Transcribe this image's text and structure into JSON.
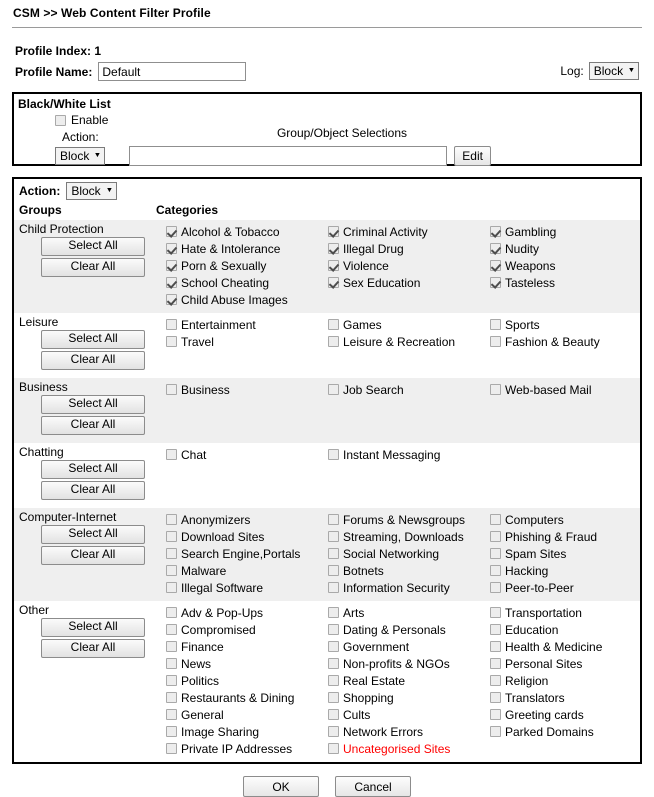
{
  "header": {
    "breadcrumb": "CSM >> Web Content Filter Profile"
  },
  "profile": {
    "index_label": "Profile Index: 1",
    "name_label": "Profile Name:",
    "name_value": "Default",
    "log_label": "Log:",
    "log_value": "Block"
  },
  "black_white_list": {
    "title": "Black/White List",
    "enable_label": "Enable",
    "enable_checked": false,
    "action_label": "Action:",
    "action_value": "Block",
    "group_object_label": "Group/Object Selections",
    "group_object_value": "",
    "edit_label": "Edit"
  },
  "filter": {
    "action_label": "Action:",
    "action_value": "Block",
    "groups_header": "Groups",
    "categories_header": "Categories",
    "select_all_label": "Select All",
    "clear_all_label": "Clear All",
    "groups": [
      {
        "name": "Child Protection",
        "shaded": true,
        "columns": [
          [
            {
              "label": "Alcohol & Tobacco",
              "checked": true
            },
            {
              "label": "Hate & Intolerance",
              "checked": true
            },
            {
              "label": "Porn & Sexually",
              "checked": true
            },
            {
              "label": "School Cheating",
              "checked": true
            },
            {
              "label": "Child Abuse Images",
              "checked": true
            }
          ],
          [
            {
              "label": "Criminal Activity",
              "checked": true
            },
            {
              "label": "Illegal Drug",
              "checked": true
            },
            {
              "label": "Violence",
              "checked": true
            },
            {
              "label": "Sex Education",
              "checked": true
            }
          ],
          [
            {
              "label": "Gambling",
              "checked": true
            },
            {
              "label": "Nudity",
              "checked": true
            },
            {
              "label": "Weapons",
              "checked": true
            },
            {
              "label": "Tasteless",
              "checked": true
            }
          ]
        ]
      },
      {
        "name": "Leisure",
        "shaded": false,
        "columns": [
          [
            {
              "label": "Entertainment",
              "checked": false
            },
            {
              "label": "Travel",
              "checked": false
            }
          ],
          [
            {
              "label": "Games",
              "checked": false
            },
            {
              "label": "Leisure & Recreation",
              "checked": false
            }
          ],
          [
            {
              "label": "Sports",
              "checked": false
            },
            {
              "label": "Fashion & Beauty",
              "checked": false
            }
          ]
        ]
      },
      {
        "name": "Business",
        "shaded": true,
        "columns": [
          [
            {
              "label": "Business",
              "checked": false
            }
          ],
          [
            {
              "label": "Job Search",
              "checked": false
            }
          ],
          [
            {
              "label": "Web-based Mail",
              "checked": false
            }
          ]
        ]
      },
      {
        "name": "Chatting",
        "shaded": false,
        "columns": [
          [
            {
              "label": "Chat",
              "checked": false
            }
          ],
          [
            {
              "label": "Instant Messaging",
              "checked": false
            }
          ],
          []
        ]
      },
      {
        "name": "Computer-Internet",
        "shaded": true,
        "columns": [
          [
            {
              "label": "Anonymizers",
              "checked": false
            },
            {
              "label": "Download Sites",
              "checked": false
            },
            {
              "label": "Search Engine,Portals",
              "checked": false
            },
            {
              "label": "Malware",
              "checked": false
            },
            {
              "label": "Illegal Software",
              "checked": false
            }
          ],
          [
            {
              "label": "Forums & Newsgroups",
              "checked": false
            },
            {
              "label": "Streaming, Downloads",
              "checked": false
            },
            {
              "label": "Social Networking",
              "checked": false
            },
            {
              "label": "Botnets",
              "checked": false
            },
            {
              "label": "Information Security",
              "checked": false
            }
          ],
          [
            {
              "label": "Computers",
              "checked": false
            },
            {
              "label": "Phishing & Fraud",
              "checked": false
            },
            {
              "label": "Spam Sites",
              "checked": false
            },
            {
              "label": "Hacking",
              "checked": false
            },
            {
              "label": "Peer-to-Peer",
              "checked": false
            }
          ]
        ]
      },
      {
        "name": "Other",
        "shaded": false,
        "columns": [
          [
            {
              "label": "Adv & Pop-Ups",
              "checked": false
            },
            {
              "label": "Compromised",
              "checked": false
            },
            {
              "label": "Finance",
              "checked": false
            },
            {
              "label": "News",
              "checked": false
            },
            {
              "label": "Politics",
              "checked": false
            },
            {
              "label": "Restaurants & Dining",
              "checked": false
            },
            {
              "label": "General",
              "checked": false
            },
            {
              "label": "Image Sharing",
              "checked": false
            },
            {
              "label": "Private IP Addresses",
              "checked": false
            }
          ],
          [
            {
              "label": "Arts",
              "checked": false
            },
            {
              "label": "Dating & Personals",
              "checked": false
            },
            {
              "label": "Government",
              "checked": false
            },
            {
              "label": "Non-profits & NGOs",
              "checked": false
            },
            {
              "label": "Real Estate",
              "checked": false
            },
            {
              "label": "Shopping",
              "checked": false
            },
            {
              "label": "Cults",
              "checked": false
            },
            {
              "label": "Network Errors",
              "checked": false
            },
            {
              "label": "Uncategorised Sites",
              "checked": false,
              "highlight": true
            }
          ],
          [
            {
              "label": "Transportation",
              "checked": false
            },
            {
              "label": "Education",
              "checked": false
            },
            {
              "label": "Health & Medicine",
              "checked": false
            },
            {
              "label": "Personal Sites",
              "checked": false
            },
            {
              "label": "Religion",
              "checked": false
            },
            {
              "label": "Translators",
              "checked": false
            },
            {
              "label": "Greeting cards",
              "checked": false
            },
            {
              "label": "Parked Domains",
              "checked": false
            }
          ]
        ]
      }
    ]
  },
  "footer": {
    "ok_label": "OK",
    "cancel_label": "Cancel"
  },
  "colors": {
    "highlight_text": "#ff0000",
    "row_shade": "#efefef",
    "panel_border": "#000000"
  }
}
